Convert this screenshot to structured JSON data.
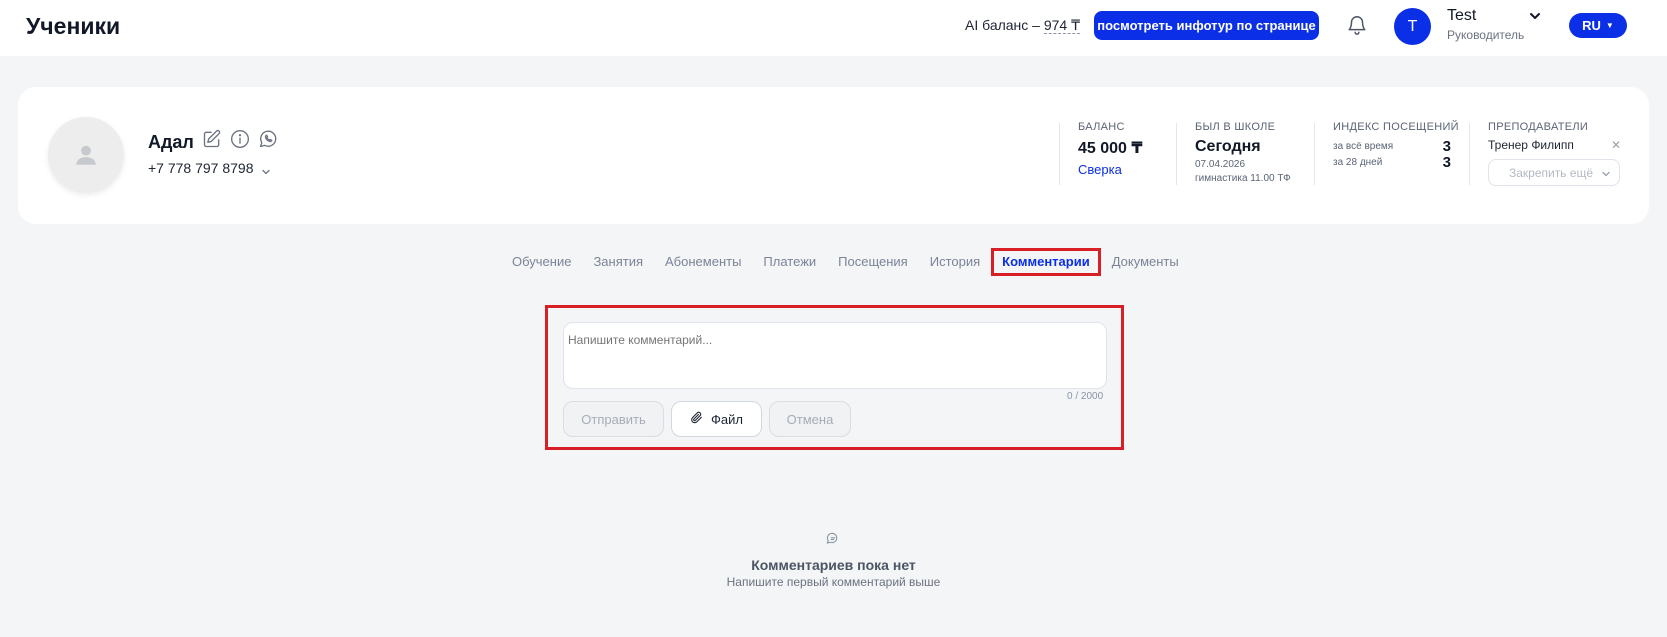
{
  "header": {
    "title": "Ученики",
    "ai_balance_label": "AI баланс –",
    "ai_balance_value": "974 ₸",
    "infotour_button": "посмотреть инфотур по странице",
    "user_initial": "T",
    "user_name": "Test",
    "user_role": "Руководитель",
    "language": "RU"
  },
  "student": {
    "name": "Адал",
    "phone": "+7 778 797 8798"
  },
  "stats": {
    "balance": {
      "label": "БАЛАНС",
      "value": "45 000 ₸",
      "link": "Сверка"
    },
    "last_seen": {
      "label": "БЫЛ В ШКОЛЕ",
      "value": "Сегодня",
      "date": "07.04.2026",
      "lesson": "гимнастика 11.00 ТФ"
    },
    "attendance": {
      "label": "ИНДЕКС ПОСЕЩЕНИЙ",
      "rows": [
        {
          "period": "за всё время",
          "value": "3"
        },
        {
          "period": "за 28 дней",
          "value": "3"
        }
      ]
    },
    "teachers": {
      "label": "ПРЕПОДАВАТЕЛИ",
      "teacher": "Тренер Филипп",
      "pin_placeholder": "Закрепить ещё"
    }
  },
  "tabs": [
    {
      "label": "Обучение",
      "active": false
    },
    {
      "label": "Занятия",
      "active": false
    },
    {
      "label": "Абонементы",
      "active": false
    },
    {
      "label": "Платежи",
      "active": false
    },
    {
      "label": "Посещения",
      "active": false
    },
    {
      "label": "История",
      "active": false
    },
    {
      "label": "Комментарии",
      "active": true
    },
    {
      "label": "Документы",
      "active": false
    }
  ],
  "comment": {
    "placeholder": "Напишите комментарий...",
    "char_count": "0 / 2000",
    "send_button": "Отправить",
    "file_button": "Файл",
    "cancel_button": "Отмена"
  },
  "empty_state": {
    "title": "Комментариев пока нет",
    "subtitle": "Напишите первый комментарий выше"
  },
  "colors": {
    "accent": "#0b2fe6",
    "highlight": "#d81f26",
    "background": "#f4f5f7"
  }
}
